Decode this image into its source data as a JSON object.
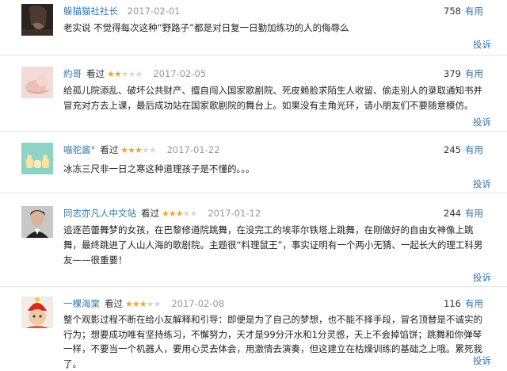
{
  "reviews": [
    {
      "user": "躲猫猫社社长",
      "seen": "",
      "stars": 0,
      "date": "2017-02-01",
      "votes": "758",
      "useful": "有用",
      "text": "老实说 不觉得每次这种“野路子”都是对日复一日勤加练功的人的侮辱么",
      "report": "投诉"
    },
    {
      "user": "約哥",
      "seen": "看过",
      "stars": 2,
      "date": "2017-02-05",
      "votes": "379",
      "useful": "有用",
      "text": "给孤儿院添乱、破坏公共财产、擅自闯入国家歌剧院、死皮赖脸求陌生人收留、偷走别人的录取通知书并冒充对方去上课，最后成功站在国家歌剧院的舞台上。如果没有主角光环，请小朋友们不要随意模仿。",
      "report": "投诉"
    },
    {
      "user": "喵驼酱°",
      "seen": "看过",
      "stars": 3,
      "date": "2017-01-22",
      "votes": "245",
      "useful": "有用",
      "text": "冰冻三尺非一日之寒这种道理孩子是不懂的。。。",
      "report": "投诉"
    },
    {
      "user": "同志亦凡人中文站",
      "seen": "看过",
      "stars": 3,
      "date": "2017-01-12",
      "votes": "244",
      "useful": "有用",
      "text": "追逐芭蕾舞梦的女孩，在巴黎修道院跳舞，在没完工的埃菲尔铁塔上跳舞，在刚做好的自由女神像上跳舞，最终跳进了人山人海的歌剧院。主题很“料理鼠王”，事实证明有一个两小无猜、一起长大的理工科男友——很重要！",
      "report": "投诉"
    },
    {
      "user": "一棵海棠",
      "seen": "看过",
      "stars": 3,
      "date": "2017-02-08",
      "votes": "116",
      "useful": "有用",
      "text": "整个观影过程不断在给小友解释和引导：即便是为了自己的梦想，也不能不择手段，冒名顶替是不诚实的行为；想要成功唯有坚持练习，不懈努力，天才是99分汗水和1分灵感，天上不会掉馅饼；跳舞和你弹琴一样，不要当一个机器人，要用心灵去体会，用激情去演奏，但这建立在枯燥训练的基础之上哦。累死我了。",
      "report": "投诉"
    }
  ]
}
